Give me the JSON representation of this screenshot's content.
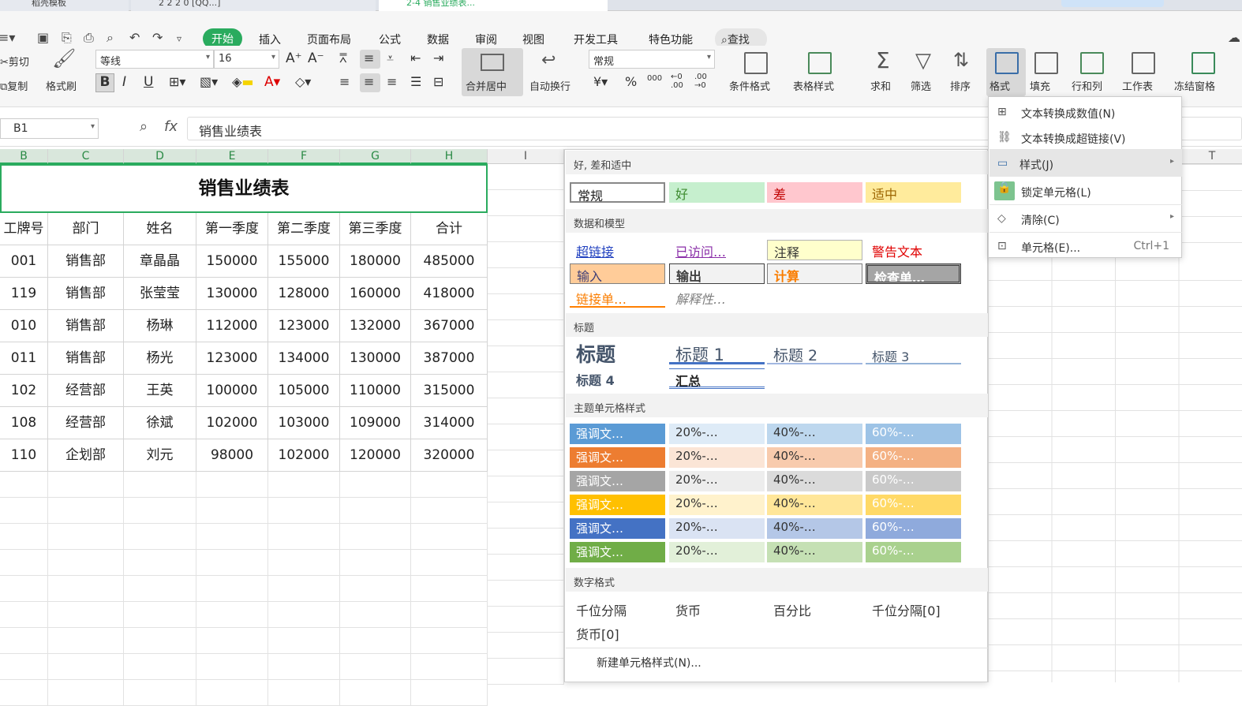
{
  "tabs": [
    "稻壳模板",
    "2 2 2 0 [QQ...]",
    "2-4 销售业绩表..."
  ],
  "menu": [
    "开始",
    "插入",
    "页面布局",
    "公式",
    "数据",
    "审阅",
    "视图",
    "开发工具",
    "特色功能"
  ],
  "search": "查找",
  "ribbon": {
    "cut": "剪切",
    "copy": "复制",
    "format_painter": "格式刷",
    "font": "等线",
    "size": "16",
    "merge": "合并居中",
    "wrap": "自动换行",
    "numfmt": "常规",
    "cond": "条件格式",
    "table_style": "表格样式",
    "sum": "求和",
    "filter": "筛选",
    "sort": "排序",
    "format": "格式",
    "fill": "填充",
    "rowcol": "行和列",
    "sheet": "工作表",
    "freeze": "冻结窗格"
  },
  "formula": {
    "cell": "B1",
    "fx": "fx",
    "value": "销售业绩表"
  },
  "columns": [
    "B",
    "C",
    "D",
    "E",
    "F",
    "G",
    "H",
    "I",
    "T"
  ],
  "sheet": {
    "title": "销售业绩表",
    "headers": [
      "工牌号",
      "部门",
      "姓名",
      "第一季度",
      "第二季度",
      "第三季度",
      "合计"
    ],
    "rows": [
      [
        "001",
        "销售部",
        "章晶晶",
        "150000",
        "155000",
        "180000",
        "485000"
      ],
      [
        "119",
        "销售部",
        "张莹莹",
        "130000",
        "128000",
        "160000",
        "418000"
      ],
      [
        "010",
        "销售部",
        "杨琳",
        "112000",
        "123000",
        "132000",
        "367000"
      ],
      [
        "011",
        "销售部",
        "杨光",
        "123000",
        "134000",
        "130000",
        "387000"
      ],
      [
        "102",
        "经营部",
        "王英",
        "100000",
        "105000",
        "110000",
        "315000"
      ],
      [
        "108",
        "经营部",
        "徐斌",
        "102000",
        "103000",
        "109000",
        "314000"
      ],
      [
        "110",
        "企划部",
        "刘元",
        "98000",
        "102000",
        "120000",
        "320000"
      ]
    ]
  },
  "styles": {
    "sec1": "好, 差和适中",
    "good_bad": [
      "常规",
      "好",
      "差",
      "适中"
    ],
    "sec2": "数据和模型",
    "data_model": [
      "超链接",
      "已访问…",
      "注释",
      "警告文本",
      "输入",
      "输出",
      "计算",
      "检查单…",
      "链接单…",
      "解释性…"
    ],
    "sec3": "标题",
    "titles": [
      "标题",
      "标题 1",
      "标题 2",
      "标题 3",
      "标题 4",
      "汇总"
    ],
    "sec4": "主题单元格样式",
    "theme": [
      "强调文…",
      "20%-…",
      "40%-…",
      "60%-…"
    ],
    "sec5": "数字格式",
    "numbers": [
      "千位分隔",
      "货币",
      "百分比",
      "千位分隔[0]",
      "货币[0]"
    ],
    "new_style": "新建单元格样式(N)..."
  },
  "context_menu": [
    {
      "label": "文本转换成数值(N)",
      "icon": "number-convert-icon"
    },
    {
      "label": "文本转换成超链接(V)",
      "icon": "link-convert-icon"
    },
    {
      "label": "样式(J)",
      "icon": "style-icon"
    },
    {
      "label": "锁定单元格(L)",
      "icon": "lock-cell-icon"
    },
    {
      "label": "清除(C)",
      "icon": "eraser-icon"
    },
    {
      "label": "单元格(E)...",
      "icon": "cell-format-icon",
      "shortcut": "Ctrl+1"
    }
  ],
  "colors": {
    "accent": "#2aab5e"
  }
}
